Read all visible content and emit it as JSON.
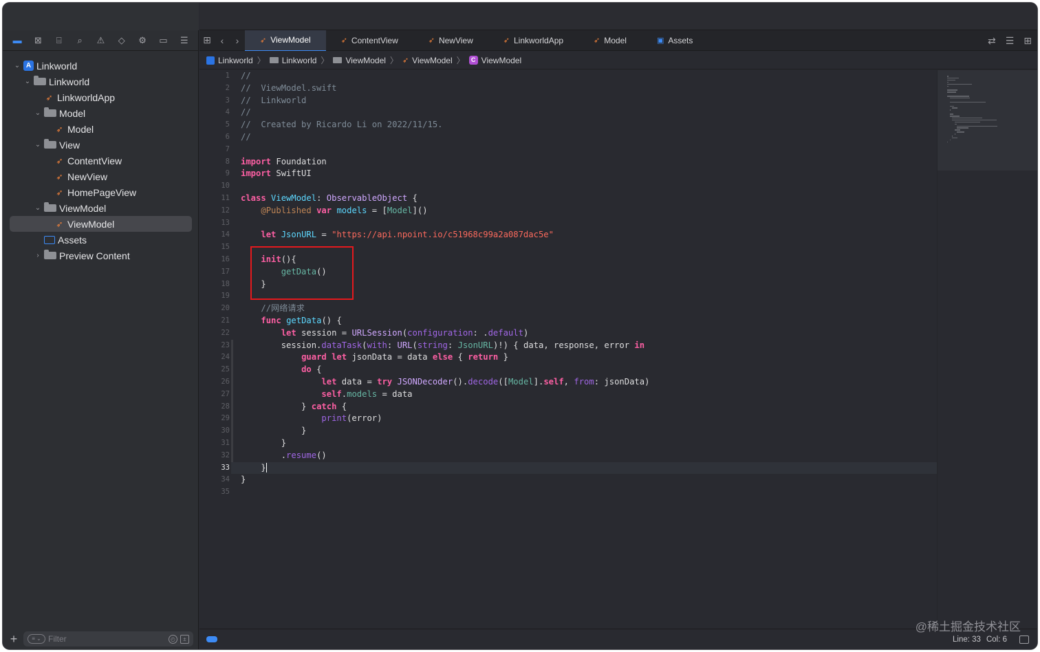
{
  "navigator_icons": [
    "folder-icon",
    "source-control-icon",
    "symbol-icon",
    "find-icon",
    "issue-icon",
    "test-icon",
    "debug-icon",
    "breakpoint-icon",
    "report-icon"
  ],
  "tree": [
    {
      "label": "Linkworld",
      "level": 0,
      "kind": "project",
      "expanded": true
    },
    {
      "label": "Linkworld",
      "level": 1,
      "kind": "folder",
      "expanded": true
    },
    {
      "label": "LinkworldApp",
      "level": 2,
      "kind": "swift"
    },
    {
      "label": "Model",
      "level": 2,
      "kind": "folder",
      "expanded": true
    },
    {
      "label": "Model",
      "level": 3,
      "kind": "swift"
    },
    {
      "label": "View",
      "level": 2,
      "kind": "folder",
      "expanded": true
    },
    {
      "label": "ContentView",
      "level": 3,
      "kind": "swift"
    },
    {
      "label": "NewView",
      "level": 3,
      "kind": "swift"
    },
    {
      "label": "HomePageView",
      "level": 3,
      "kind": "swift"
    },
    {
      "label": "ViewModel",
      "level": 2,
      "kind": "folder",
      "expanded": true
    },
    {
      "label": "ViewModel",
      "level": 3,
      "kind": "swift",
      "selected": true
    },
    {
      "label": "Assets",
      "level": 2,
      "kind": "assets"
    },
    {
      "label": "Preview Content",
      "level": 2,
      "kind": "folder",
      "expanded": false
    }
  ],
  "filter": {
    "placeholder": "Filter"
  },
  "tabs": [
    {
      "label": "ViewModel",
      "kind": "swift",
      "active": true
    },
    {
      "label": "ContentView",
      "kind": "swift"
    },
    {
      "label": "NewView",
      "kind": "swift"
    },
    {
      "label": "LinkworldApp",
      "kind": "swift"
    },
    {
      "label": "Model",
      "kind": "swift"
    },
    {
      "label": "Assets",
      "kind": "assets"
    }
  ],
  "breadcrumb": [
    {
      "label": "Linkworld",
      "kind": "project"
    },
    {
      "label": "Linkworld",
      "kind": "folder"
    },
    {
      "label": "ViewModel",
      "kind": "folder"
    },
    {
      "label": "ViewModel",
      "kind": "swift"
    },
    {
      "label": "ViewModel",
      "kind": "class"
    }
  ],
  "current_line": 33,
  "code_lines": [
    [
      [
        "c-comment",
        "//"
      ]
    ],
    [
      [
        "c-comment",
        "//  ViewModel.swift"
      ]
    ],
    [
      [
        "c-comment",
        "//  Linkworld"
      ]
    ],
    [
      [
        "c-comment",
        "//"
      ]
    ],
    [
      [
        "c-comment",
        "//  Created by Ricardo Li on 2022/11/15."
      ]
    ],
    [
      [
        "c-comment",
        "//"
      ]
    ],
    [],
    [
      [
        "c-kw",
        "import"
      ],
      [
        "",
        " Foundation"
      ]
    ],
    [
      [
        "c-kw",
        "import"
      ],
      [
        "",
        " SwiftUI"
      ]
    ],
    [],
    [
      [
        "c-kw",
        "class"
      ],
      [
        "",
        " "
      ],
      [
        "c-decl",
        "ViewModel"
      ],
      [
        "",
        ": "
      ],
      [
        "c-type",
        "ObservableObject"
      ],
      [
        "",
        " {"
      ]
    ],
    [
      [
        "",
        "    "
      ],
      [
        "c-attr",
        "@Published"
      ],
      [
        "",
        " "
      ],
      [
        "c-kw",
        "var"
      ],
      [
        "",
        " "
      ],
      [
        "c-decl",
        "models"
      ],
      [
        "",
        " = ["
      ],
      [
        "c-proj",
        "Model"
      ],
      [
        "",
        "]()"
      ]
    ],
    [],
    [
      [
        "",
        "    "
      ],
      [
        "c-kw",
        "let"
      ],
      [
        "",
        " "
      ],
      [
        "c-decl",
        "JsonURL"
      ],
      [
        "",
        " = "
      ],
      [
        "c-str",
        "\"https://api.npoint.io/c51968c99a2a087dac5e\""
      ]
    ],
    [],
    [
      [
        "",
        "    "
      ],
      [
        "c-kw",
        "init"
      ],
      [
        "",
        "(){"
      ]
    ],
    [
      [
        "",
        "        "
      ],
      [
        "c-proj",
        "getData"
      ],
      [
        "",
        "()"
      ]
    ],
    [
      [
        "",
        "    }"
      ]
    ],
    [],
    [
      [
        "",
        "    "
      ],
      [
        "c-comment",
        "//网络请求"
      ]
    ],
    [
      [
        "",
        "    "
      ],
      [
        "c-kw",
        "func"
      ],
      [
        "",
        " "
      ],
      [
        "c-decl",
        "getData"
      ],
      [
        "",
        "() {"
      ]
    ],
    [
      [
        "",
        "        "
      ],
      [
        "c-kw",
        "let"
      ],
      [
        "",
        " session = "
      ],
      [
        "c-type",
        "URLSession"
      ],
      [
        "",
        "("
      ],
      [
        "c-fn",
        "configuration"
      ],
      [
        "",
        ": ."
      ],
      [
        "c-fn",
        "default"
      ],
      [
        "",
        ")"
      ]
    ],
    [
      [
        "",
        "        session."
      ],
      [
        "c-fn",
        "dataTask"
      ],
      [
        "",
        "("
      ],
      [
        "c-fn",
        "with"
      ],
      [
        "",
        ": "
      ],
      [
        "c-type",
        "URL"
      ],
      [
        "",
        "("
      ],
      [
        "c-fn",
        "string"
      ],
      [
        "",
        ": "
      ],
      [
        "c-proj",
        "JsonURL"
      ],
      [
        "",
        ")!) { data, response, error "
      ],
      [
        "c-kw",
        "in"
      ]
    ],
    [
      [
        "",
        "            "
      ],
      [
        "c-kw",
        "guard"
      ],
      [
        "",
        " "
      ],
      [
        "c-kw",
        "let"
      ],
      [
        "",
        " jsonData = data "
      ],
      [
        "c-kw",
        "else"
      ],
      [
        "",
        " { "
      ],
      [
        "c-kw",
        "return"
      ],
      [
        "",
        " }"
      ]
    ],
    [
      [
        "",
        "            "
      ],
      [
        "c-kw",
        "do"
      ],
      [
        "",
        " {"
      ]
    ],
    [
      [
        "",
        "                "
      ],
      [
        "c-kw",
        "let"
      ],
      [
        "",
        " data = "
      ],
      [
        "c-kw",
        "try"
      ],
      [
        "",
        " "
      ],
      [
        "c-type",
        "JSONDecoder"
      ],
      [
        "",
        "()."
      ],
      [
        "c-fn",
        "decode"
      ],
      [
        "",
        "(["
      ],
      [
        "c-proj",
        "Model"
      ],
      [
        "",
        "]."
      ],
      [
        "c-kw",
        "self"
      ],
      [
        "",
        ", "
      ],
      [
        "c-fn",
        "from"
      ],
      [
        "",
        ": jsonData)"
      ]
    ],
    [
      [
        "",
        "                "
      ],
      [
        "c-kw",
        "self"
      ],
      [
        "",
        "."
      ],
      [
        "c-proj",
        "models"
      ],
      [
        "",
        " = data"
      ]
    ],
    [
      [
        "",
        "            } "
      ],
      [
        "c-kw",
        "catch"
      ],
      [
        "",
        " {"
      ]
    ],
    [
      [
        "",
        "                "
      ],
      [
        "c-fn",
        "print"
      ],
      [
        "",
        "(error)"
      ]
    ],
    [
      [
        "",
        "            }"
      ]
    ],
    [
      [
        "",
        "        }"
      ]
    ],
    [
      [
        "",
        "        ."
      ],
      [
        "c-fn",
        "resume"
      ],
      [
        "",
        "()"
      ]
    ],
    [
      [
        "",
        "    }"
      ]
    ],
    [
      [
        "",
        "}"
      ]
    ],
    []
  ],
  "status": {
    "line": "Line: 33",
    "col": "Col: 6"
  },
  "watermark": "@稀土掘金技术社区",
  "colors": {
    "accent": "#3d8bf5",
    "swift": "#f0813a",
    "highlight_box": "#e5191d"
  }
}
